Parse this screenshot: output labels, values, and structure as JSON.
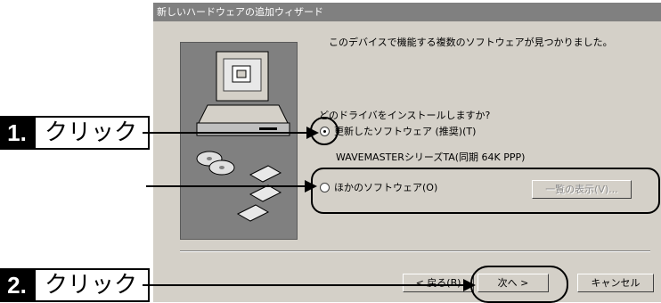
{
  "dialog": {
    "title": "新しいハードウェアの追加ウィザード",
    "message": "このデバイスで機能する複数のソフトウェアが見つかりました。",
    "question": "どのドライバをインストールしますか?",
    "option1_label": "更新したソフトウェア (推奨)(T)",
    "option1_sub": "WAVEMASTERシリーズTA(同期 64K PPP)",
    "option2_label": "ほかのソフトウェア(O)",
    "list_button": "一覧の表示(V)...",
    "back_button": "< 戻る(B)",
    "next_button": "次へ >",
    "cancel_button": "キャンセル"
  },
  "annotations": {
    "step1_num": "1.",
    "step1_text": "クリック",
    "step2_num": "2.",
    "step2_text": "クリック"
  }
}
